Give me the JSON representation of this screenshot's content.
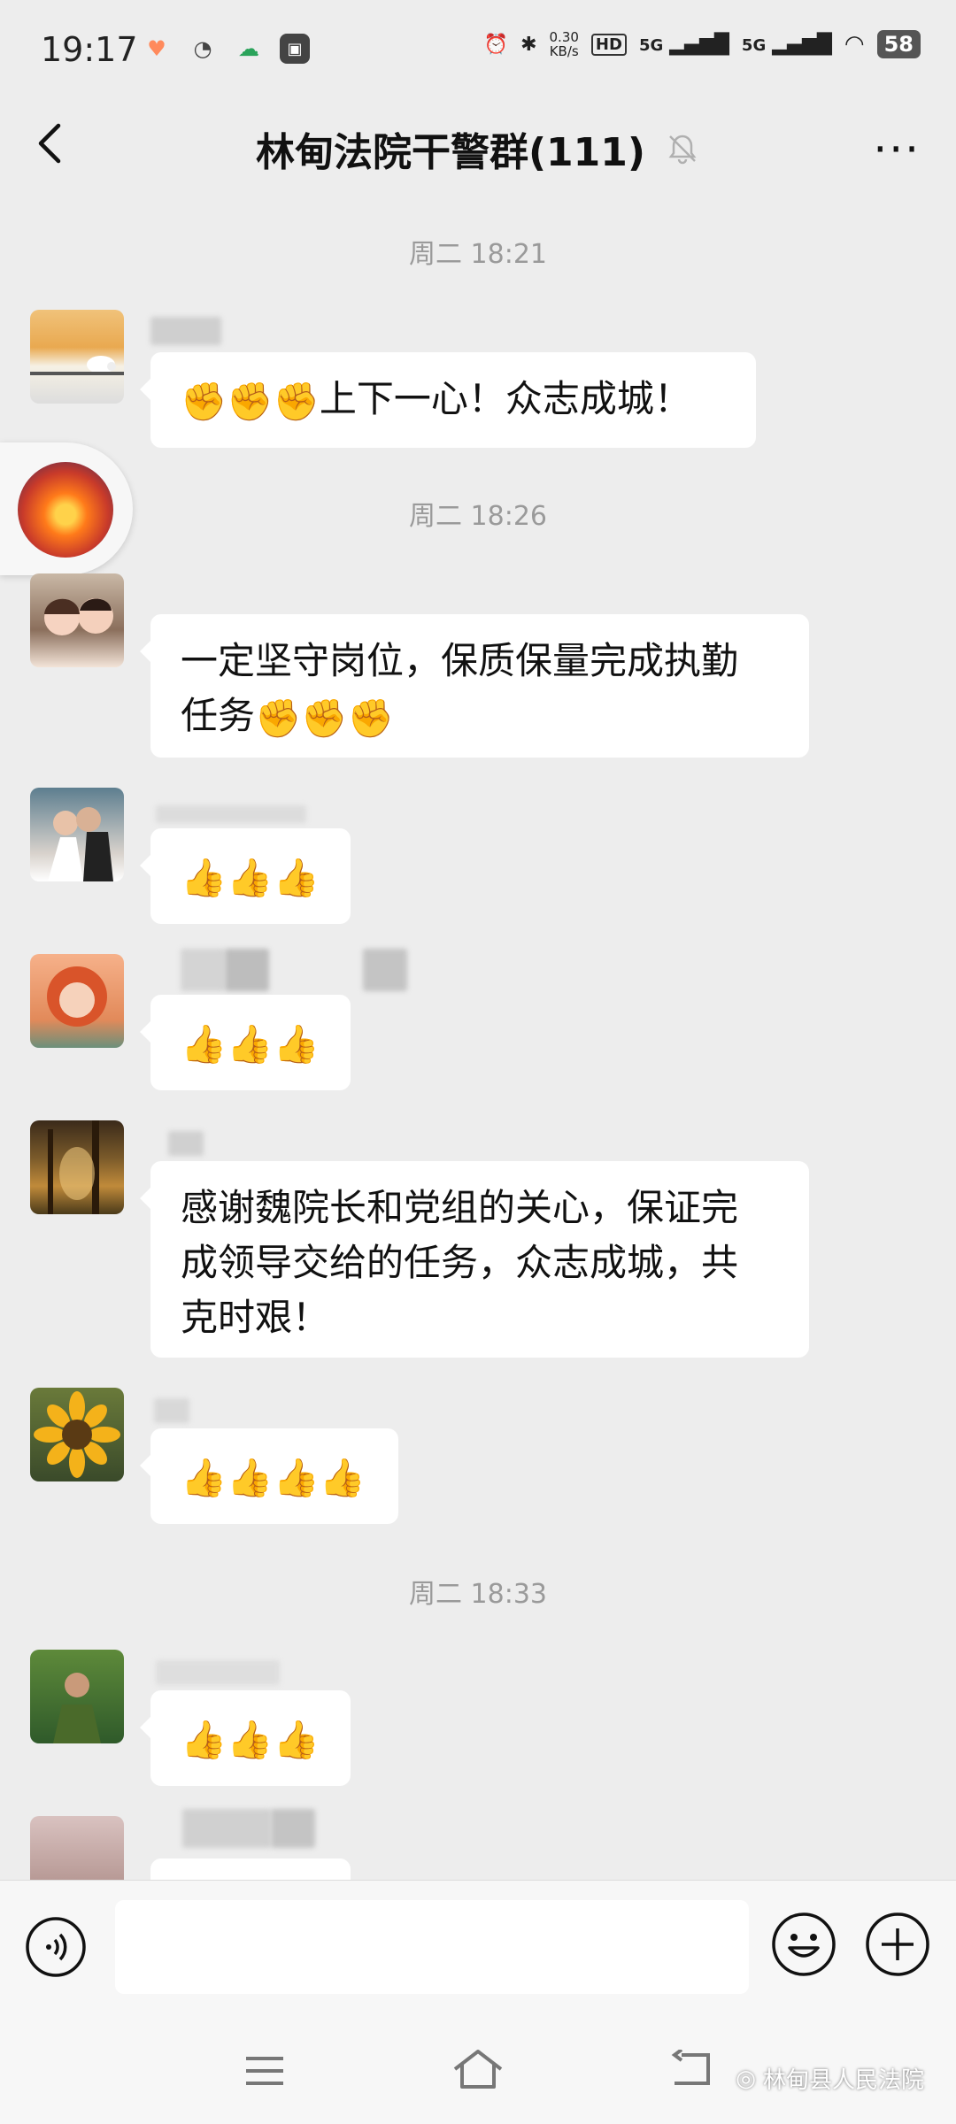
{
  "status_bar": {
    "time": "19:17",
    "net_speed_value": "0.30",
    "net_speed_unit": "KB/s",
    "hd": "HD",
    "sig1": "5G",
    "sig2": "5G",
    "battery": "58"
  },
  "header": {
    "title": "林甸法院干警群(111)",
    "muted_icon": "bell-muted-icon",
    "more": "···"
  },
  "timestamps": [
    "周二 18:21",
    "周二 18:26",
    "周二 18:33"
  ],
  "messages": [
    {
      "text": "上下一心！众志成城！",
      "emoji": "fist",
      "emoji_count_before": 3
    },
    {
      "line1": "一定坚守岗位，保质保量完成执勤",
      "line2": "任务",
      "emoji": "fist",
      "emoji_count_after": 3
    },
    {
      "emoji": "thumbs-up",
      "count": 3
    },
    {
      "emoji": "thumbs-up",
      "count": 3
    },
    {
      "line1": "感谢魏院长和党组的关心，保证完",
      "line2": "成领导交给的任务，众志成城，共",
      "line3": "克时艰！"
    },
    {
      "emoji": "thumbs-up",
      "count": 4
    },
    {
      "emoji": "thumbs-up",
      "count": 3
    }
  ],
  "input": {
    "placeholder": ""
  },
  "watermark": "林甸县人民法院",
  "colors": {
    "background": "#ededed",
    "bubble": "#ffffff",
    "timestamp": "#9a9a9a"
  }
}
